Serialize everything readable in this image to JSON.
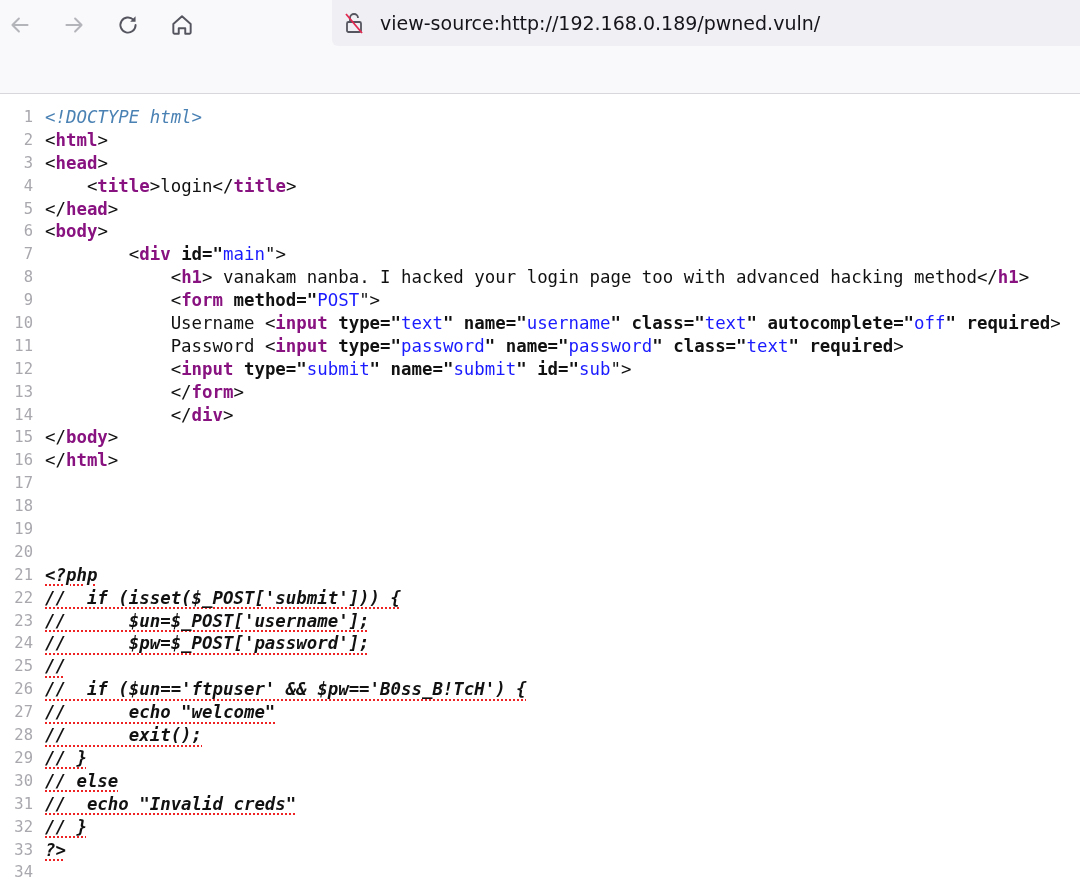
{
  "toolbar": {
    "buttons": [
      {
        "kind": "back",
        "disabled": true
      },
      {
        "kind": "forward",
        "disabled": true
      },
      {
        "kind": "reload",
        "disabled": false
      },
      {
        "kind": "home",
        "disabled": false
      }
    ],
    "address_bar": {
      "secure": false,
      "value": "view-source:http://192.168.0.189/pwned.vuln/"
    }
  },
  "source": {
    "lines": [
      {
        "number": "1",
        "tokens": [
          {
            "kind": "doctype",
            "text": "<!DOCTYPE html>"
          }
        ]
      },
      {
        "number": "2",
        "tokens": [
          {
            "kind": "punct",
            "text": "<"
          },
          {
            "kind": "tag",
            "text": "html"
          },
          {
            "kind": "punct",
            "text": ">"
          }
        ]
      },
      {
        "number": "3",
        "tokens": [
          {
            "kind": "punct",
            "text": "<"
          },
          {
            "kind": "tag",
            "text": "head"
          },
          {
            "kind": "punct",
            "text": ">"
          }
        ]
      },
      {
        "number": "4",
        "tokens": [
          {
            "kind": "punct",
            "text": "    <"
          },
          {
            "kind": "tag",
            "text": "title"
          },
          {
            "kind": "punct",
            "text": ">"
          },
          {
            "kind": "text",
            "text": "login"
          },
          {
            "kind": "punct",
            "text": "</"
          },
          {
            "kind": "tag",
            "text": "title"
          },
          {
            "kind": "punct",
            "text": ">"
          }
        ]
      },
      {
        "number": "5",
        "tokens": [
          {
            "kind": "punct",
            "text": "</"
          },
          {
            "kind": "tag",
            "text": "head"
          },
          {
            "kind": "punct",
            "text": ">"
          }
        ]
      },
      {
        "number": "6",
        "tokens": [
          {
            "kind": "punct",
            "text": "<"
          },
          {
            "kind": "tag",
            "text": "body"
          },
          {
            "kind": "punct",
            "text": ">"
          }
        ]
      },
      {
        "number": "7",
        "tokens": [
          {
            "kind": "punct",
            "text": "        <"
          },
          {
            "kind": "tag",
            "text": "div"
          },
          {
            "kind": "attr",
            "text": " id=\""
          },
          {
            "kind": "value",
            "text": "main"
          },
          {
            "kind": "punct",
            "text": "\">"
          }
        ]
      },
      {
        "number": "8",
        "tokens": [
          {
            "kind": "punct",
            "text": "            <"
          },
          {
            "kind": "tag",
            "text": "h1"
          },
          {
            "kind": "punct",
            "text": ">"
          },
          {
            "kind": "text",
            "text": " vanakam nanba. I hacked your login page too with advanced hacking method"
          },
          {
            "kind": "punct",
            "text": "</"
          },
          {
            "kind": "tag",
            "text": "h1"
          },
          {
            "kind": "punct",
            "text": ">"
          }
        ]
      },
      {
        "number": "9",
        "tokens": [
          {
            "kind": "punct",
            "text": "            <"
          },
          {
            "kind": "tag",
            "text": "form"
          },
          {
            "kind": "attr",
            "text": " method=\""
          },
          {
            "kind": "value",
            "text": "POST"
          },
          {
            "kind": "punct",
            "text": "\">"
          }
        ]
      },
      {
        "number": "10",
        "tokens": [
          {
            "kind": "text",
            "text": "            Username "
          },
          {
            "kind": "punct",
            "text": "<"
          },
          {
            "kind": "tag",
            "text": "input"
          },
          {
            "kind": "attr",
            "text": " type=\""
          },
          {
            "kind": "value",
            "text": "text"
          },
          {
            "kind": "attr",
            "text": "\" name=\""
          },
          {
            "kind": "value",
            "text": "username"
          },
          {
            "kind": "attr",
            "text": "\" class=\""
          },
          {
            "kind": "value",
            "text": "text"
          },
          {
            "kind": "attr",
            "text": "\" autocomplete=\""
          },
          {
            "kind": "value",
            "text": "off"
          },
          {
            "kind": "attr",
            "text": "\" required"
          },
          {
            "kind": "punct",
            "text": ">"
          }
        ]
      },
      {
        "number": "11",
        "tokens": [
          {
            "kind": "text",
            "text": "            Password "
          },
          {
            "kind": "punct",
            "text": "<"
          },
          {
            "kind": "tag",
            "text": "input"
          },
          {
            "kind": "attr",
            "text": " type=\""
          },
          {
            "kind": "value",
            "text": "password"
          },
          {
            "kind": "attr",
            "text": "\" name=\""
          },
          {
            "kind": "value",
            "text": "password"
          },
          {
            "kind": "attr",
            "text": "\" class=\""
          },
          {
            "kind": "value",
            "text": "text"
          },
          {
            "kind": "attr",
            "text": "\" required"
          },
          {
            "kind": "punct",
            "text": ">"
          }
        ]
      },
      {
        "number": "12",
        "tokens": [
          {
            "kind": "punct",
            "text": "            <"
          },
          {
            "kind": "tag",
            "text": "input"
          },
          {
            "kind": "attr",
            "text": " type=\""
          },
          {
            "kind": "value",
            "text": "submit"
          },
          {
            "kind": "attr",
            "text": "\" name=\""
          },
          {
            "kind": "value",
            "text": "submit"
          },
          {
            "kind": "attr",
            "text": "\" id=\""
          },
          {
            "kind": "value",
            "text": "sub"
          },
          {
            "kind": "punct",
            "text": "\">"
          }
        ]
      },
      {
        "number": "13",
        "tokens": [
          {
            "kind": "punct",
            "text": "            </"
          },
          {
            "kind": "tag",
            "text": "form"
          },
          {
            "kind": "punct",
            "text": ">"
          }
        ]
      },
      {
        "number": "14",
        "tokens": [
          {
            "kind": "punct",
            "text": "            </"
          },
          {
            "kind": "tag",
            "text": "div"
          },
          {
            "kind": "punct",
            "text": ">"
          }
        ]
      },
      {
        "number": "15",
        "tokens": [
          {
            "kind": "punct",
            "text": "</"
          },
          {
            "kind": "tag",
            "text": "body"
          },
          {
            "kind": "punct",
            "text": ">"
          }
        ]
      },
      {
        "number": "16",
        "tokens": [
          {
            "kind": "punct",
            "text": "</"
          },
          {
            "kind": "tag",
            "text": "html"
          },
          {
            "kind": "punct",
            "text": ">"
          }
        ]
      },
      {
        "number": "17"
      },
      {
        "number": "18"
      },
      {
        "number": "19"
      },
      {
        "number": "20"
      },
      {
        "number": "21",
        "tokens": [
          {
            "kind": "error",
            "text": "<?php"
          }
        ]
      },
      {
        "number": "22",
        "tokens": [
          {
            "kind": "error",
            "text": "//  if (isset($_POST['submit'])) {"
          }
        ]
      },
      {
        "number": "23",
        "tokens": [
          {
            "kind": "error",
            "text": "//      $un=$_POST['username'];"
          }
        ]
      },
      {
        "number": "24",
        "tokens": [
          {
            "kind": "error",
            "text": "//      $pw=$_POST['password'];"
          }
        ]
      },
      {
        "number": "25",
        "tokens": [
          {
            "kind": "error",
            "text": "//"
          }
        ]
      },
      {
        "number": "26",
        "tokens": [
          {
            "kind": "error",
            "text": "//  if ($un=='ftpuser' && $pw=='B0ss_B!TcH') {"
          }
        ]
      },
      {
        "number": "27",
        "tokens": [
          {
            "kind": "error",
            "text": "//      echo \"welcome\""
          }
        ]
      },
      {
        "number": "28",
        "tokens": [
          {
            "kind": "error",
            "text": "//      exit();"
          }
        ]
      },
      {
        "number": "29",
        "tokens": [
          {
            "kind": "error",
            "text": "// }"
          }
        ]
      },
      {
        "number": "30",
        "tokens": [
          {
            "kind": "error",
            "text": "// else"
          }
        ]
      },
      {
        "number": "31",
        "tokens": [
          {
            "kind": "error",
            "text": "//  echo \"Invalid creds\""
          }
        ]
      },
      {
        "number": "32",
        "tokens": [
          {
            "kind": "error",
            "text": "// }"
          }
        ]
      },
      {
        "number": "33",
        "tokens": [
          {
            "kind": "error",
            "text": "?>"
          }
        ]
      },
      {
        "number": "34"
      }
    ]
  }
}
